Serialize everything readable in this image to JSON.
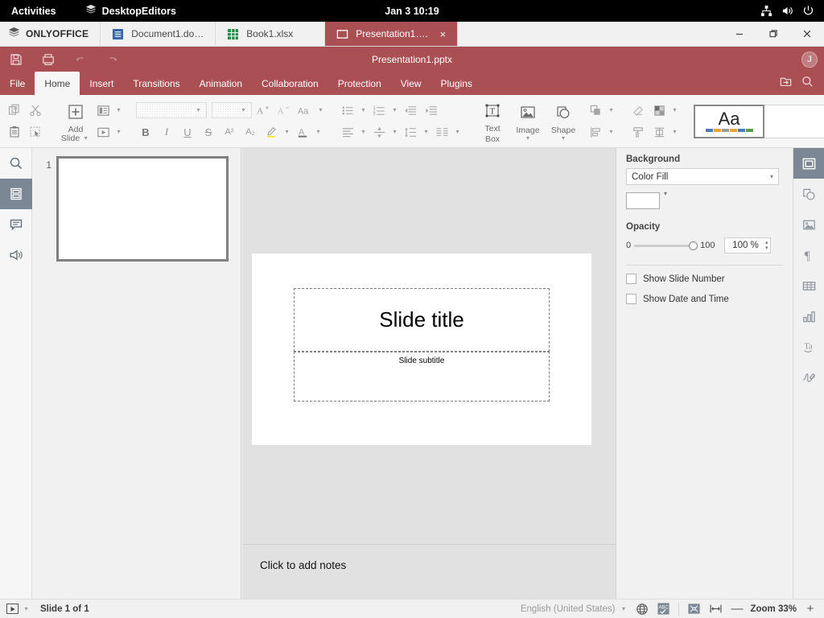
{
  "os_bar": {
    "activities": "Activities",
    "app_name": "DesktopEditors",
    "clock": "Jan 3  10:19",
    "icons": [
      "network-icon",
      "volume-icon",
      "power-icon"
    ]
  },
  "tabbar": {
    "brand": "ONLYOFFICE",
    "tabs": [
      {
        "label": "Document1.do…",
        "icon": "document-icon",
        "active": false
      },
      {
        "label": "Book1.xlsx",
        "icon": "spreadsheet-icon",
        "active": false
      },
      {
        "label": "Presentation1….",
        "icon": "presentation-icon",
        "active": true,
        "close": "×"
      }
    ],
    "window_controls": {
      "minimize": "—",
      "maximize": "❐",
      "close": "✕"
    }
  },
  "header": {
    "doc_title": "Presentation1.pptx",
    "quick_access": [
      "save-icon",
      "print-icon",
      "undo-icon",
      "redo-icon"
    ],
    "avatar_initial": "J",
    "menu_tabs": [
      {
        "label": "File",
        "active": false
      },
      {
        "label": "Home",
        "active": true
      },
      {
        "label": "Insert",
        "active": false
      },
      {
        "label": "Transitions",
        "active": false
      },
      {
        "label": "Animation",
        "active": false
      },
      {
        "label": "Collaboration",
        "active": false
      },
      {
        "label": "Protection",
        "active": false
      },
      {
        "label": "View",
        "active": false
      },
      {
        "label": "Plugins",
        "active": false
      }
    ],
    "right_icons": [
      "open-file-location-icon",
      "search-icon"
    ],
    "accent_color": "#aa5055"
  },
  "ribbon": {
    "clipboard": [
      "copy-icon",
      "cut-icon",
      "paste-icon",
      "select-all-icon"
    ],
    "add_slide": {
      "label_line1": "Add",
      "label_line2": "Slide"
    },
    "slide_layout_icon": "slide-layout-icon",
    "slide_transition_icon": "start-slideshow-icon",
    "font_name": "",
    "font_size": "",
    "font_tools": [
      "increase-font-icon",
      "decrease-font-icon",
      "change-case-icon"
    ],
    "format_buttons": [
      {
        "name": "bold",
        "glyph": "B"
      },
      {
        "name": "italic",
        "glyph": "I"
      },
      {
        "name": "underline",
        "glyph": "U"
      },
      {
        "name": "strikethrough",
        "glyph": "S"
      },
      {
        "name": "superscript",
        "glyph": "A²"
      },
      {
        "name": "subscript",
        "glyph": "A₂"
      }
    ],
    "highlight_icon": "highlight-color-icon",
    "fontcolor_icon": "font-color-icon",
    "paragraph": [
      "bullets-icon",
      "numbering-icon",
      "decrease-indent-icon",
      "increase-indent-icon",
      "horizontal-align-icon",
      "vertical-align-icon",
      "line-spacing-icon",
      "columns-icon"
    ],
    "insert": [
      {
        "name": "text-box",
        "line1": "Text",
        "line2": "Box"
      },
      {
        "name": "image",
        "line1": "Image",
        "line2": ""
      },
      {
        "name": "shape",
        "line1": "Shape",
        "line2": ""
      }
    ],
    "arrange_icons": [
      "arrange-shape-icon",
      "align-shape-icon"
    ],
    "style_icons": [
      "clear-style-icon",
      "shape-fill-icon",
      "copy-style-icon",
      "select-shape-icon"
    ],
    "theme": {
      "preview_text": "Aa",
      "swatch_colors": [
        "#4a7ebb",
        "#e8a33d",
        "#9b9b9b",
        "#e8a33d",
        "#4a7ebb",
        "#5b9b4a"
      ]
    }
  },
  "left_rail": {
    "items": [
      {
        "name": "search-icon",
        "active": false
      },
      {
        "name": "slides-icon",
        "active": true
      },
      {
        "name": "comments-icon",
        "active": false
      },
      {
        "name": "feedback-icon",
        "active": false
      }
    ]
  },
  "thumbnails": {
    "slides": [
      {
        "number": "1"
      }
    ]
  },
  "slide": {
    "title": "Slide title",
    "subtitle": "Slide subtitle"
  },
  "notes": {
    "placeholder": "Click to add notes"
  },
  "right_panel": {
    "section_title": "Background",
    "fill_type": "Color Fill",
    "fill_color": "#ffffff",
    "opacity_label": "Opacity",
    "opacity_min": "0",
    "opacity_max": "100",
    "opacity_value": "100 %",
    "checkboxes": [
      {
        "label": "Show Slide Number",
        "checked": false
      },
      {
        "label": "Show Date and Time",
        "checked": false
      }
    ]
  },
  "right_rail": {
    "items": [
      {
        "name": "slide-settings-icon",
        "active": true
      },
      {
        "name": "shape-settings-icon",
        "active": false
      },
      {
        "name": "image-settings-icon",
        "active": false
      },
      {
        "name": "paragraph-settings-icon",
        "active": false
      },
      {
        "name": "table-settings-icon",
        "active": false
      },
      {
        "name": "chart-settings-icon",
        "active": false
      },
      {
        "name": "text-art-settings-icon",
        "active": false
      },
      {
        "name": "signature-settings-icon",
        "active": false
      }
    ]
  },
  "statusbar": {
    "start_slideshow_icon": "start-slideshow-icon",
    "slide_count": "Slide 1 of 1",
    "language": "English (United States)",
    "globe_icon": "set-language-icon",
    "spellcheck_icon": "spellcheck-icon",
    "fit_slide_icon": "fit-to-slide-icon",
    "fit_width_icon": "fit-to-width-icon",
    "zoom_out": "—",
    "zoom_label": "Zoom 33%",
    "zoom_in": "+"
  }
}
